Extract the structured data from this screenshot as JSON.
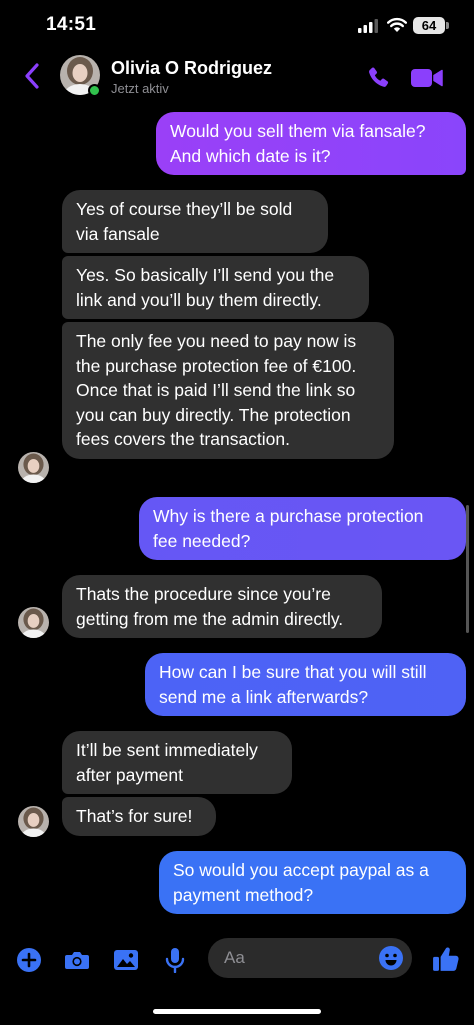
{
  "status_bar": {
    "time": "14:51",
    "battery": "64"
  },
  "header": {
    "contact_name": "Olivia O Rodriguez",
    "contact_status": "Jetzt aktiv"
  },
  "messages": [
    {
      "from": "me",
      "text": "Would you sell them via fansale? And which date is it?"
    },
    {
      "from": "them",
      "text": "Yes of course they’ll be sold via fansale"
    },
    {
      "from": "them",
      "text": "Yes. So basically I’ll send you the link and you’ll buy them directly."
    },
    {
      "from": "them",
      "text": "The only fee you need to pay now is the purchase protection fee of €100. Once that is paid I’ll send the link so you can buy directly. The protection fees covers the transaction."
    },
    {
      "from": "me",
      "text": "Why is there a purchase protection fee needed?"
    },
    {
      "from": "them",
      "text": "Thats the procedure since you’re getting from me the admin directly."
    },
    {
      "from": "me",
      "text": "How can I be sure that you will still send me a link afterwards?"
    },
    {
      "from": "them",
      "text": "It’ll be sent immediately after payment"
    },
    {
      "from": "them",
      "text": "That’s for sure!"
    },
    {
      "from": "me",
      "text": "So would you accept paypal as a payment method?"
    }
  ],
  "composer": {
    "placeholder": "Aa"
  },
  "colors": {
    "accent_purple": "#8b3ffc",
    "accent_blue": "#3a72f5",
    "incoming_bubble": "#303030",
    "background": "#000000"
  },
  "icons": [
    "back-icon",
    "call-icon",
    "video-icon",
    "plus-icon",
    "camera-icon",
    "image-icon",
    "microphone-icon",
    "emoji-icon",
    "thumbs-up-icon"
  ]
}
